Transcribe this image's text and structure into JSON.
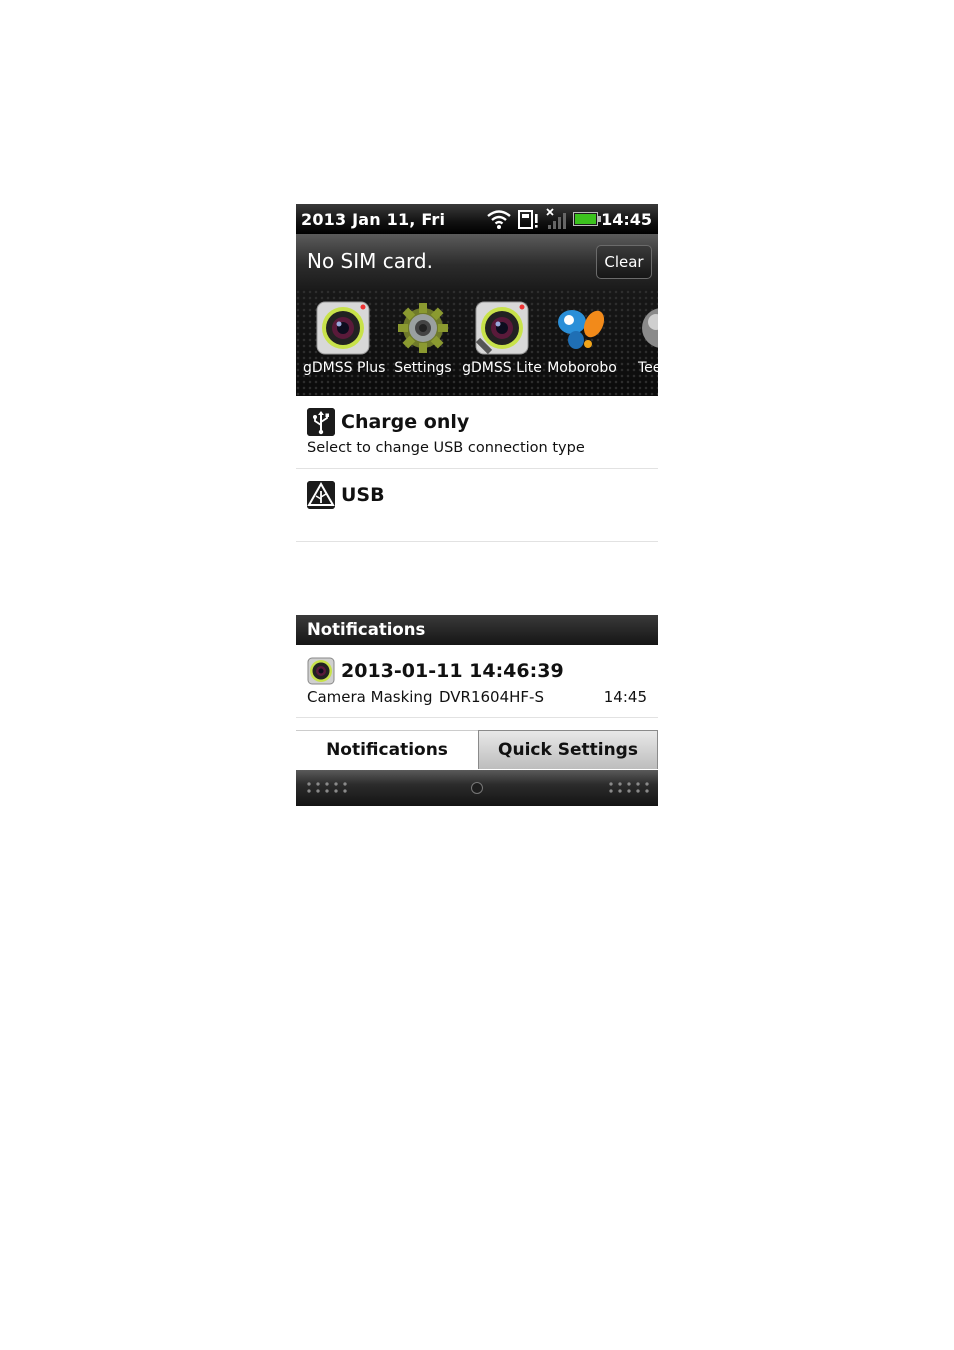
{
  "status_bar": {
    "date": "2013 Jan 11, Fri",
    "time": "14:45",
    "icons": [
      "wifi-icon",
      "sd-card-warning-icon",
      "no-signal-icon",
      "battery-icon"
    ]
  },
  "header": {
    "title": "No SIM card.",
    "clear_label": "Clear"
  },
  "recent_apps": [
    {
      "label": "gDMSS Plus",
      "icon": "camera-lens-icon"
    },
    {
      "label": "Settings",
      "icon": "gear-icon"
    },
    {
      "label": "gDMSS Lite",
      "icon": "camera-lens-icon"
    },
    {
      "label": "Moborobo",
      "icon": "butterfly-icon"
    },
    {
      "label": "Tee",
      "icon": "app-icon"
    }
  ],
  "ongoing": [
    {
      "title": "Charge only",
      "subtitle": "Select to change USB connection type",
      "icon": "usb-icon"
    },
    {
      "title": "USB",
      "icon": "usb-debug-warning-icon"
    }
  ],
  "notifications": {
    "header": "Notifications",
    "items": [
      {
        "title": "2013-01-11 14:46:39",
        "text": "Camera Masking",
        "device": "DVR1604HF-S",
        "time": "14:45",
        "icon": "camera-lens-icon"
      }
    ]
  },
  "tabs": {
    "notifications_label": "Notifications",
    "quick_settings_label": "Quick Settings"
  },
  "colors": {
    "battery_green": "#3cc21e",
    "bar_dark": "#111111"
  }
}
